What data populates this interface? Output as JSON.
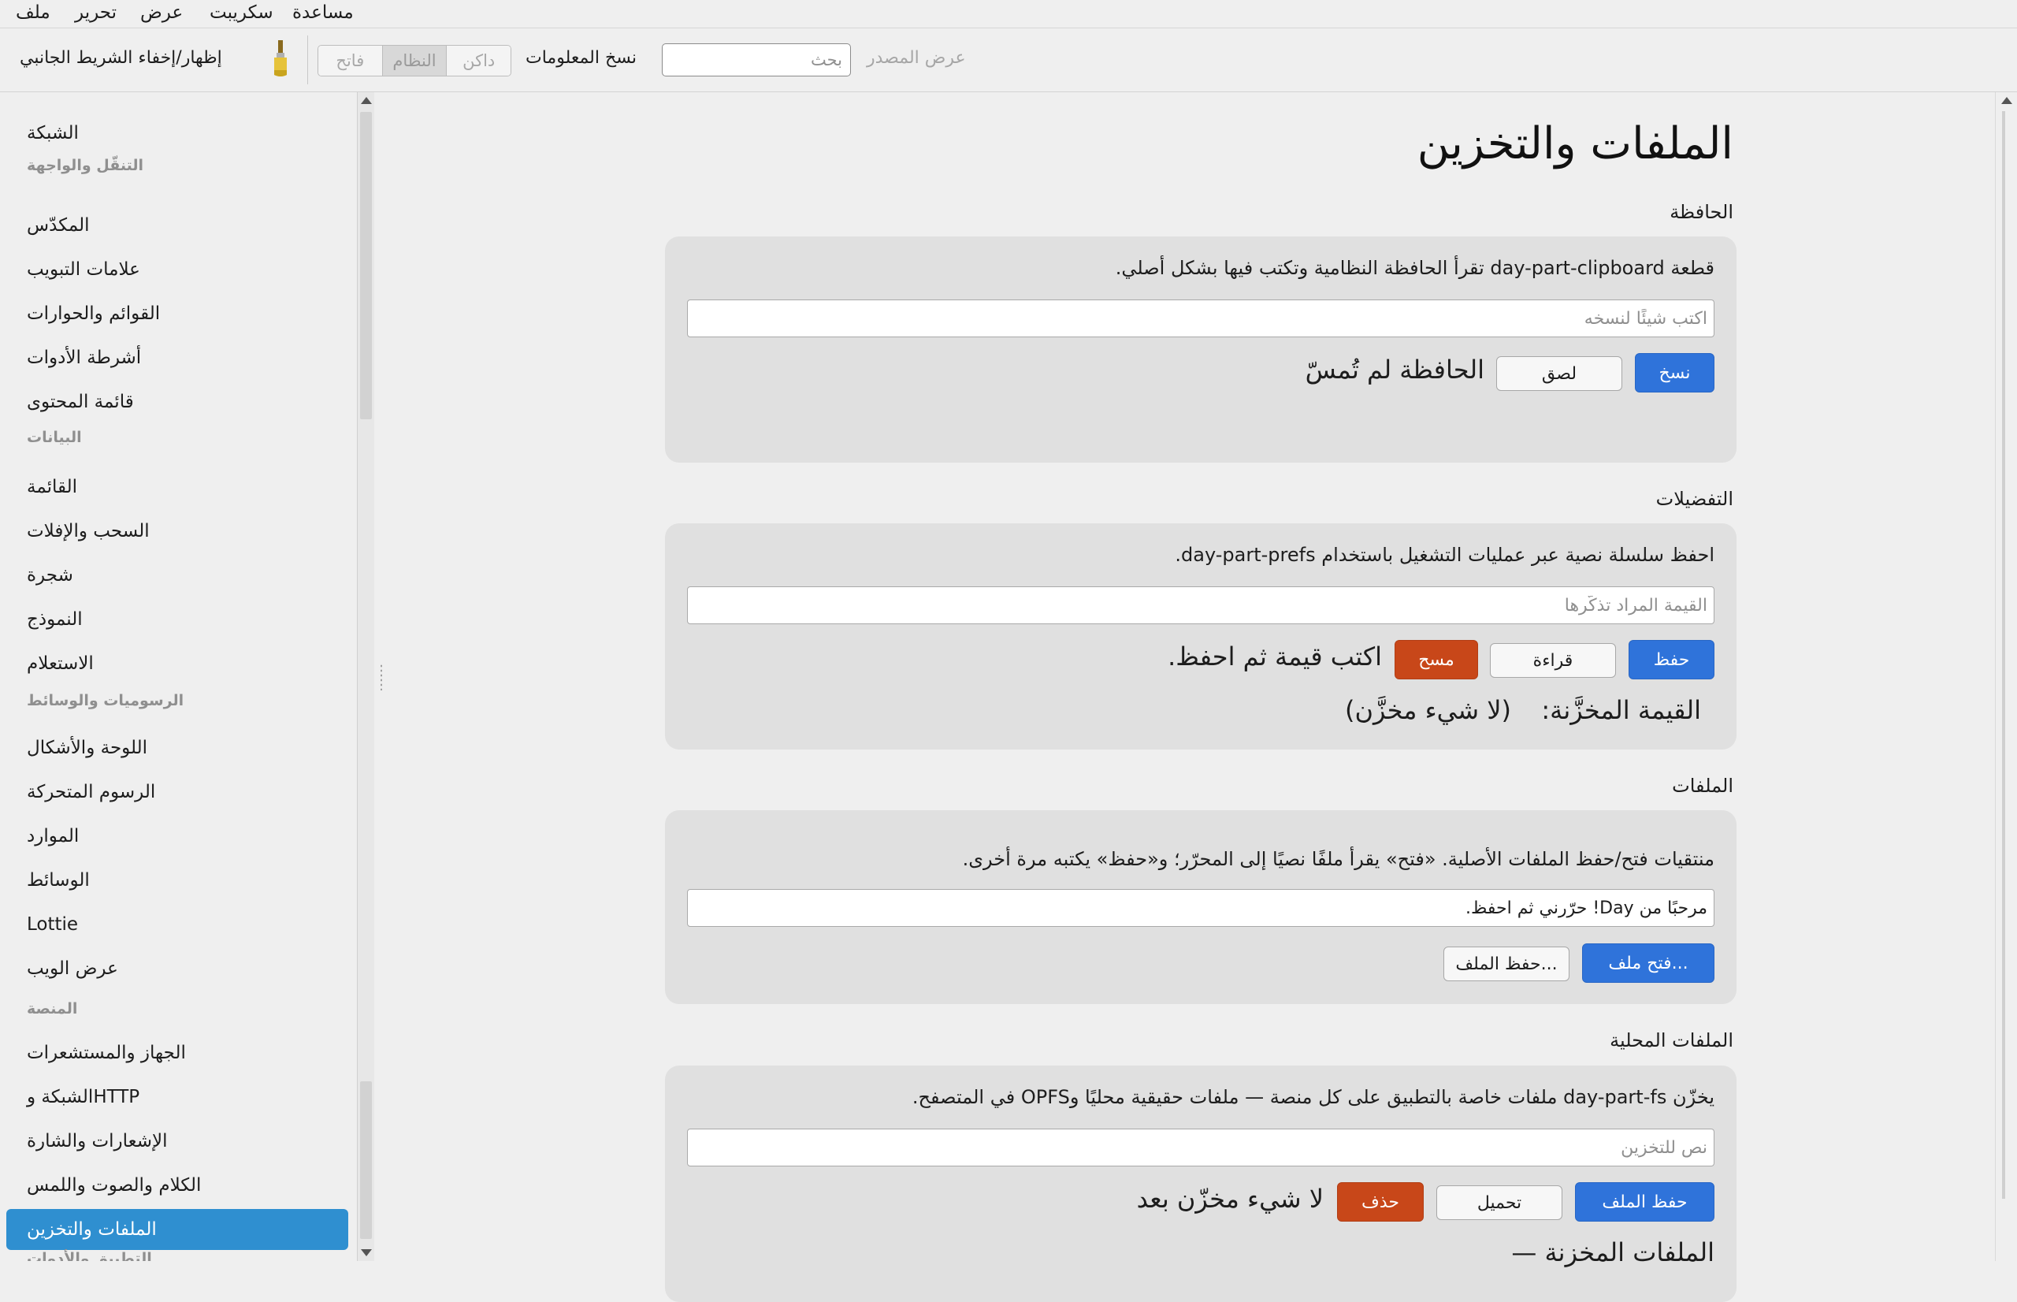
{
  "menubar": {
    "items": [
      "ملف",
      "تحرير",
      "عرض",
      "سكريبت",
      "مساعدة"
    ]
  },
  "toolbar": {
    "toggle_sidebar": "إظهار/إخفاء الشريط الجانبي",
    "theme_buttons": [
      "فاتح",
      "النظام",
      "داكن"
    ],
    "copy_info": "نسخ المعلومات",
    "search_placeholder": "بحث",
    "view_source": "عرض المصدر"
  },
  "sidebar": {
    "entries": [
      {
        "type": "item",
        "label": "الشبكة"
      },
      {
        "type": "header",
        "label": "التنقّل والواجهة"
      },
      {
        "type": "item",
        "label": "المكدّس"
      },
      {
        "type": "item",
        "label": "علامات التبويب"
      },
      {
        "type": "item",
        "label": "القوائم والحوارات"
      },
      {
        "type": "item",
        "label": "أشرطة الأدوات"
      },
      {
        "type": "item",
        "label": "قائمة المحتوى"
      },
      {
        "type": "header",
        "label": "البيانات"
      },
      {
        "type": "item",
        "label": "القائمة"
      },
      {
        "type": "item",
        "label": "السحب والإفلات"
      },
      {
        "type": "item",
        "label": "شجرة"
      },
      {
        "type": "item",
        "label": "النموذج"
      },
      {
        "type": "item",
        "label": "الاستعلام"
      },
      {
        "type": "header",
        "label": "الرسوميات والوسائط"
      },
      {
        "type": "item",
        "label": "اللوحة والأشكال"
      },
      {
        "type": "item",
        "label": "الرسوم المتحركة"
      },
      {
        "type": "item",
        "label": "الموارد"
      },
      {
        "type": "item",
        "label": "الوسائط"
      },
      {
        "type": "item",
        "label": "Lottie"
      },
      {
        "type": "item",
        "label": "عرض الويب"
      },
      {
        "type": "header",
        "label": "المنصة"
      },
      {
        "type": "item",
        "label": "الجهاز والمستشعرات"
      },
      {
        "type": "item",
        "label": "الشبكة وHTTP"
      },
      {
        "type": "item",
        "label": "الإشعارات والشارة"
      },
      {
        "type": "item",
        "label": "الكلام والصوت واللمس"
      },
      {
        "type": "item",
        "label": "الملفات والتخزين",
        "selected": true
      },
      {
        "type": "header",
        "label": "التطبيق والأدوات"
      }
    ]
  },
  "main": {
    "title": "الملفات والتخزين",
    "clipboard": {
      "section": "الحافظة",
      "desc": "قطعة day-part-clipboard تقرأ الحافظة النظامية وتكتب فيها بشكل أصلي.",
      "input_placeholder": "اكتب شيئًا لنسخه",
      "copy_btn": "نسخ",
      "paste_btn": "لصق",
      "status": "الحافظة لم تُمسّ"
    },
    "prefs": {
      "section": "التفضيلات",
      "desc": "احفظ سلسلة نصية عبر عمليات التشغيل باستخدام day-part-prefs.",
      "input_placeholder": "القيمة المراد تذكّرها",
      "save_btn": "حفظ",
      "read_btn": "قراءة",
      "clear_btn": "مسح",
      "status": "اكتب قيمة ثم احفظ.",
      "stored_label": "القيمة المخزَّنة:",
      "stored_value": "(لا شيء مخزَّن)"
    },
    "files": {
      "section": "الملفات",
      "desc": "منتقيات فتح/حفظ الملفات الأصلية. «فتح» يقرأ ملفًا نصيًا إلى المحرّر؛ و«حفظ» يكتبه مرة أخرى.",
      "input_value": "مرحبًا من Day! حرّرني ثم احفظ.",
      "open_btn": "فتح ملف...",
      "save_btn": "حفظ الملف..."
    },
    "local_files": {
      "section": "الملفات المحلية",
      "desc": "يخزّن day-part-fs ملفات خاصة بالتطبيق على كل منصة — ملفات حقيقية محليًا وOPFS في المتصفح.",
      "input_placeholder": "نص للتخزين",
      "save_btn": "حفظ الملف",
      "load_btn": "تحميل",
      "delete_btn": "حذف",
      "status": "لا شيء مخزّن بعد",
      "stored_files_label": "الملفات المخزنة —"
    }
  }
}
